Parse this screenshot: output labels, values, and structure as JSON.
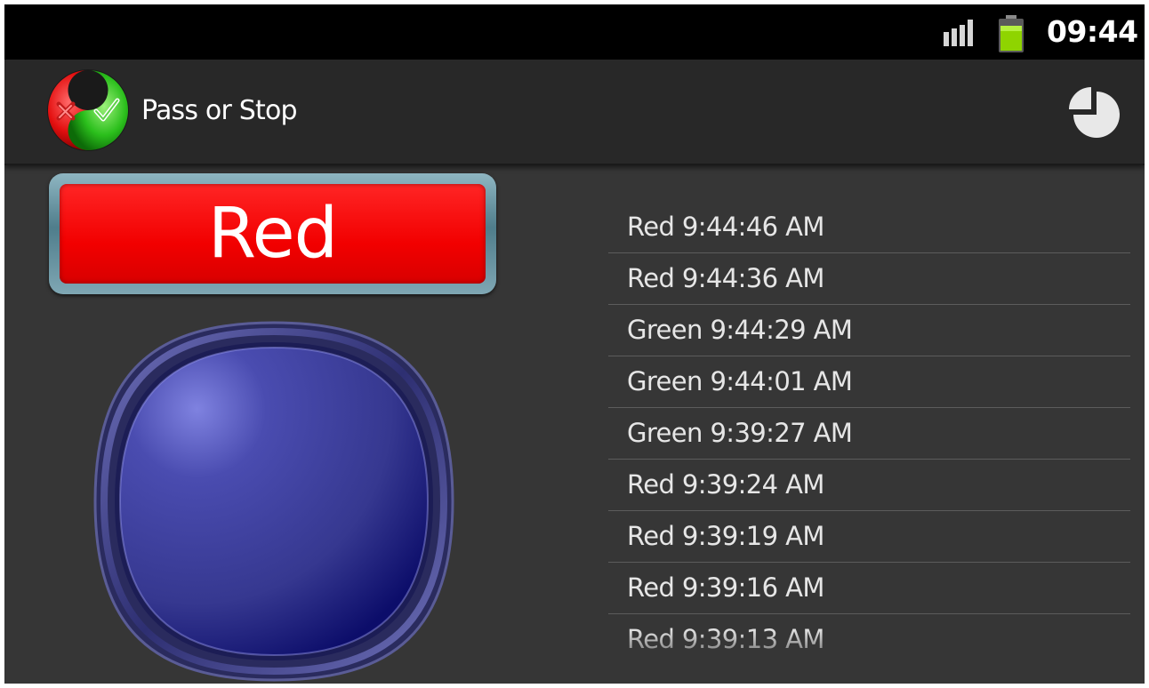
{
  "status_bar": {
    "time": "09:44",
    "icons": [
      "signal-icon",
      "battery-icon"
    ],
    "battery_color": "#8fd400"
  },
  "action_bar": {
    "title": "Pass or Stop",
    "logo_icon": "pass-stop-logo-icon",
    "action_icon": "pie-chart-icon"
  },
  "current_color": {
    "label": "Red",
    "color": "#f20000"
  },
  "big_button": {
    "color": "#3a3b8f"
  },
  "history": [
    "Red 9:44:46 AM",
    "Red 9:44:36 AM",
    "Green 9:44:29 AM",
    "Green 9:44:01 AM",
    "Green 9:39:27 AM",
    "Red 9:39:24 AM",
    "Red 9:39:19 AM",
    "Red 9:39:16 AM",
    "Red 9:39:13 AM"
  ]
}
